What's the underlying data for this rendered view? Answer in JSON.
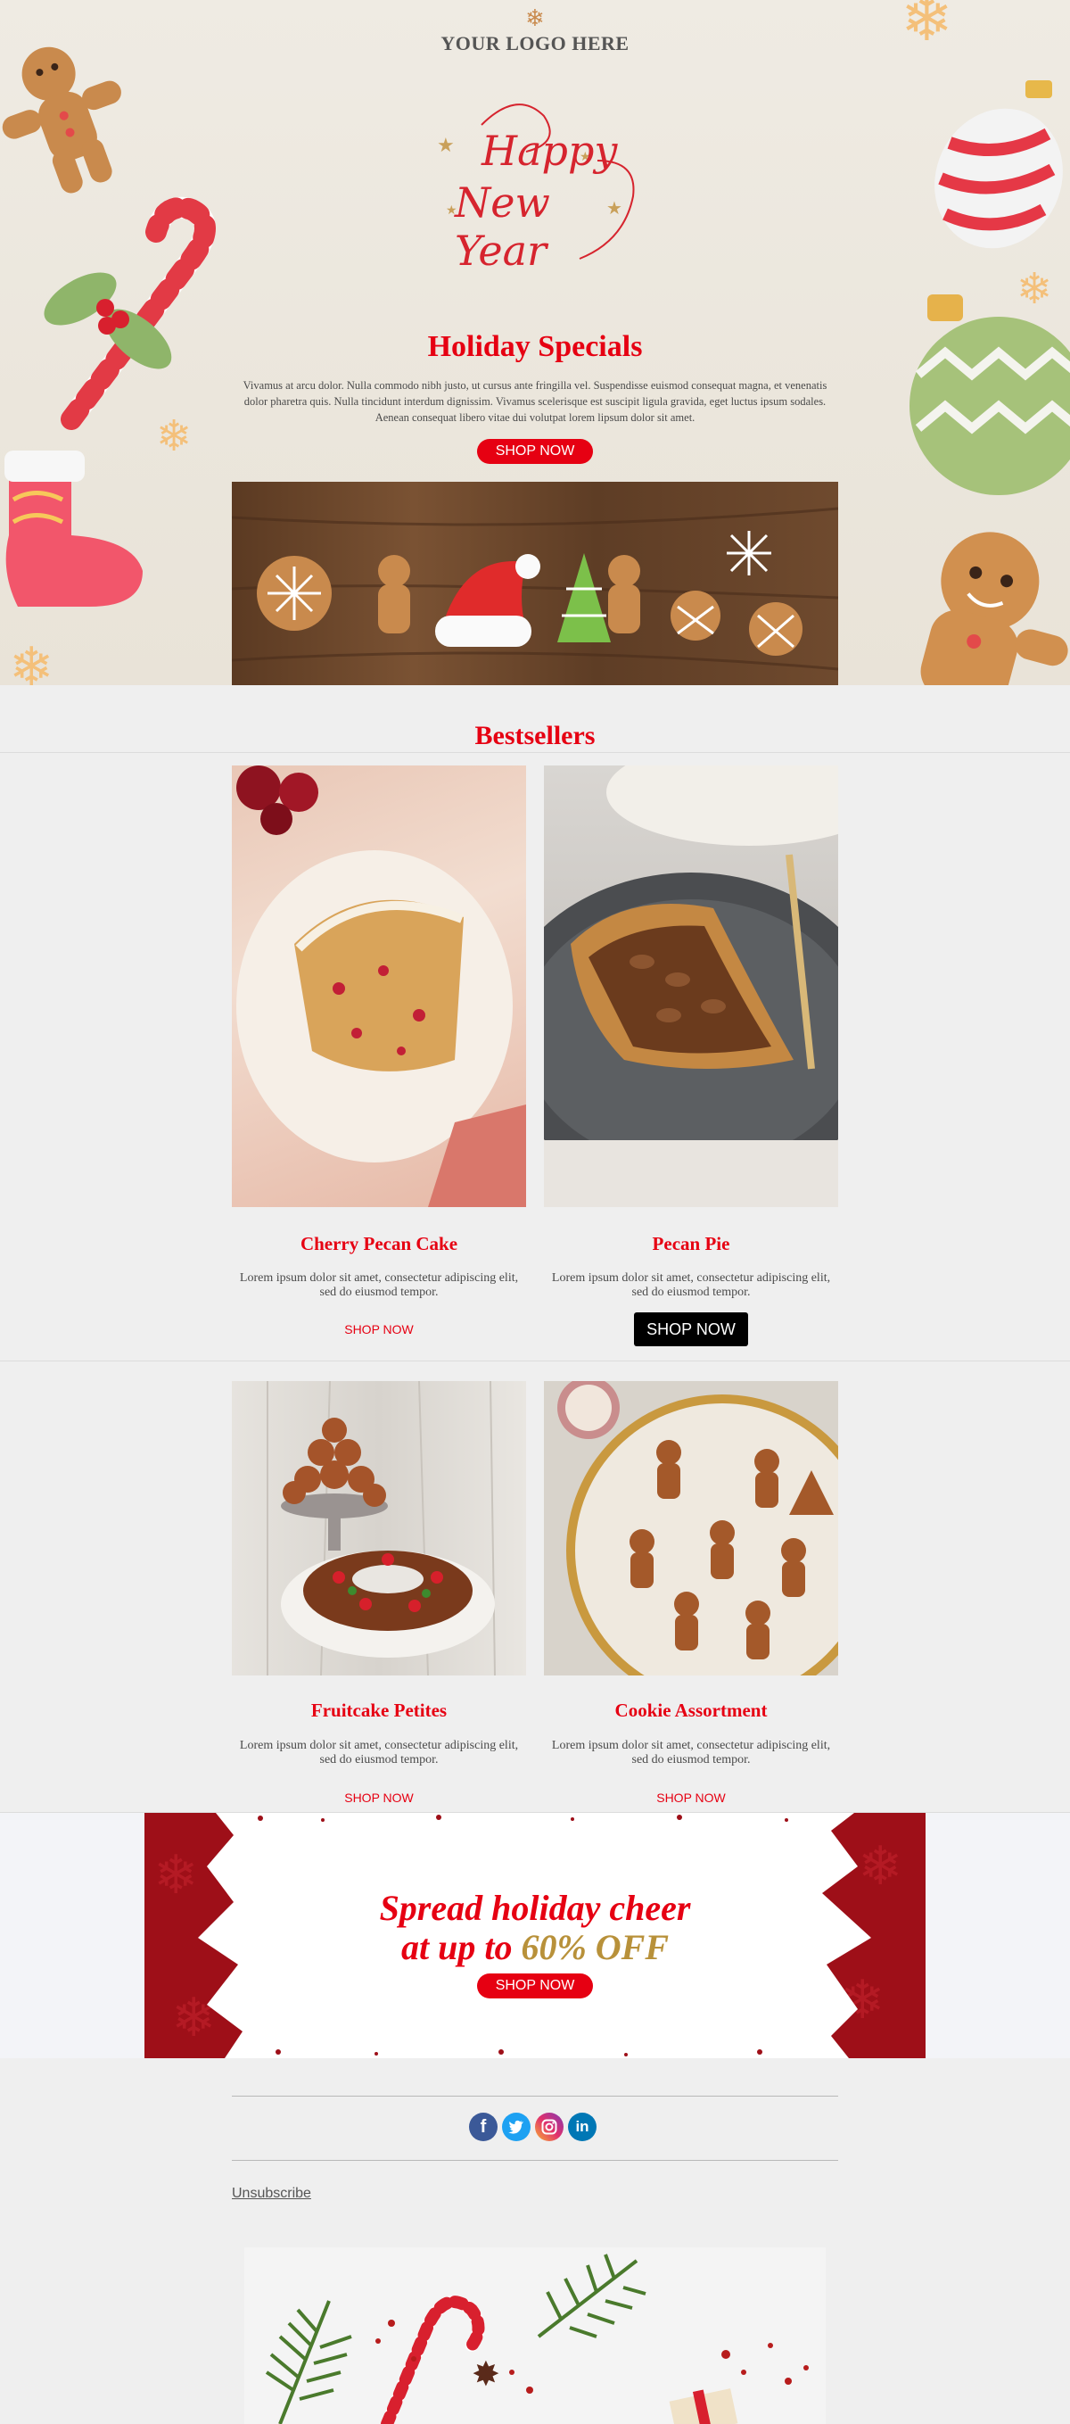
{
  "header": {
    "logo_text": "YOUR LOGO HERE",
    "greeting_line1": "Happy",
    "greeting_line2": "New Year"
  },
  "hero": {
    "title": "Holiday Specials",
    "body": "Vivamus at arcu dolor. Nulla commodo nibh justo, ut cursus ante fringilla vel. Suspendisse euismod consequat magna, et venenatis dolor pharetra quis. Nulla tincidunt interdum dignissim. Vivamus scelerisque est suscipit ligula gravida, eget luctus ipsum sodales. Aenean consequat libero vitae dui volutpat lorem lipsum dolor sit amet.",
    "button": "SHOP NOW"
  },
  "bestsellers": {
    "heading": "Bestsellers",
    "products": [
      {
        "name": "Cherry Pecan Cake",
        "desc": "Lorem ipsum dolor sit amet, consectetur adipiscing elit, sed do eiusmod tempor.",
        "cta": "SHOP NOW"
      },
      {
        "name": "Pecan Pie",
        "desc": "Lorem ipsum dolor sit amet, consectetur adipiscing elit, sed do eiusmod tempor.",
        "cta": "SHOP NOW"
      },
      {
        "name": "Fruitcake Petites",
        "desc": "Lorem ipsum dolor sit amet, consectetur adipiscing elit, sed do eiusmod tempor.",
        "cta": "SHOP NOW"
      },
      {
        "name": "Cookie Assortment",
        "desc": "Lorem ipsum dolor sit amet, consectetur adipiscing elit, sed do eiusmod tempor.",
        "cta": "SHOP NOW"
      }
    ]
  },
  "promo": {
    "line1": "Spread holiday cheer",
    "line2_prefix": "at up to ",
    "line2_highlight": "60% OFF",
    "button": "SHOP NOW"
  },
  "footer": {
    "social": [
      "facebook-icon",
      "twitter-icon",
      "instagram-icon",
      "linkedin-icon"
    ],
    "unsubscribe": "Unsubscribe"
  },
  "colors": {
    "brand_red": "#e60012",
    "gold": "#b8913a",
    "dark_red": "#9e0f18"
  }
}
